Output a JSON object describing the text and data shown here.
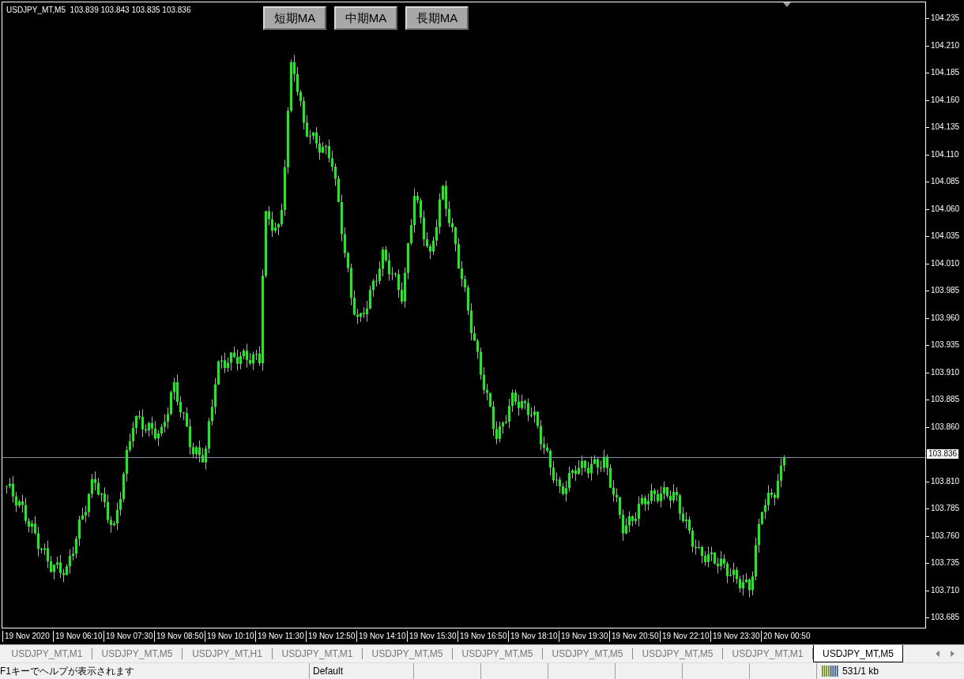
{
  "chart": {
    "header": "USDJPY_MT,M5  103.839 103.843 103.835 103.836",
    "buttons": [
      {
        "label": "短期MA"
      },
      {
        "label": "中期MA"
      },
      {
        "label": "長期MA"
      }
    ],
    "price_labels": [
      {
        "label": "104.235",
        "kind": "tick"
      },
      {
        "label": "104.210",
        "kind": "tick"
      },
      {
        "label": "104.185",
        "kind": "tick"
      },
      {
        "label": "104.160",
        "kind": "tick"
      },
      {
        "label": "104.135",
        "kind": "tick"
      },
      {
        "label": "104.110",
        "kind": "tick"
      },
      {
        "label": "104.085",
        "kind": "tick"
      },
      {
        "label": "104.060",
        "kind": "tick"
      },
      {
        "label": "104.035",
        "kind": "tick"
      },
      {
        "label": "104.010",
        "kind": "tick"
      },
      {
        "label": "103.985",
        "kind": "tick"
      },
      {
        "label": "103.960",
        "kind": "tick"
      },
      {
        "label": "103.935",
        "kind": "tick"
      },
      {
        "label": "103.910",
        "kind": "tick"
      },
      {
        "label": "103.885",
        "kind": "tick"
      },
      {
        "label": "103.860",
        "kind": "tick"
      },
      {
        "label": "103.836",
        "kind": "current"
      },
      {
        "label": "103.810",
        "kind": "tick"
      },
      {
        "label": "103.785",
        "kind": "tick"
      },
      {
        "label": "103.760",
        "kind": "tick"
      },
      {
        "label": "103.735",
        "kind": "tick"
      },
      {
        "label": "103.710",
        "kind": "tick"
      },
      {
        "label": "103.685",
        "kind": "tick"
      }
    ],
    "time_labels": [
      "19 Nov 2020",
      "19 Nov 06:10",
      "19 Nov 07:30",
      "19 Nov 08:50",
      "19 Nov 10:10",
      "19 Nov 11:30",
      "19 Nov 12:50",
      "19 Nov 14:10",
      "19 Nov 15:30",
      "19 Nov 16:50",
      "19 Nov 18:10",
      "19 Nov 19:30",
      "19 Nov 20:50",
      "19 Nov 22:10",
      "19 Nov 23:30",
      "20 Nov 00:50"
    ]
  },
  "tabs": [
    {
      "label": "USDJPY_MT,M1",
      "selected": false
    },
    {
      "label": "USDJPY_MT,M5",
      "selected": false
    },
    {
      "label": "USDJPY_MT,H1",
      "selected": false
    },
    {
      "label": "USDJPY_MT,M1",
      "selected": false
    },
    {
      "label": "USDJPY_MT,M5",
      "selected": false
    },
    {
      "label": "USDJPY_MT,M5",
      "selected": false
    },
    {
      "label": "USDJPY_MT,M5",
      "selected": false
    },
    {
      "label": "USDJPY_MT,M5",
      "selected": false
    },
    {
      "label": "USDJPY_MT,M1",
      "selected": false
    },
    {
      "label": "USDJPY_MT,M5",
      "selected": true
    }
  ],
  "status_bar": {
    "help": "F1キーでヘルプが表示されます",
    "profile": "Default",
    "traffic": "531/1 kb"
  }
}
